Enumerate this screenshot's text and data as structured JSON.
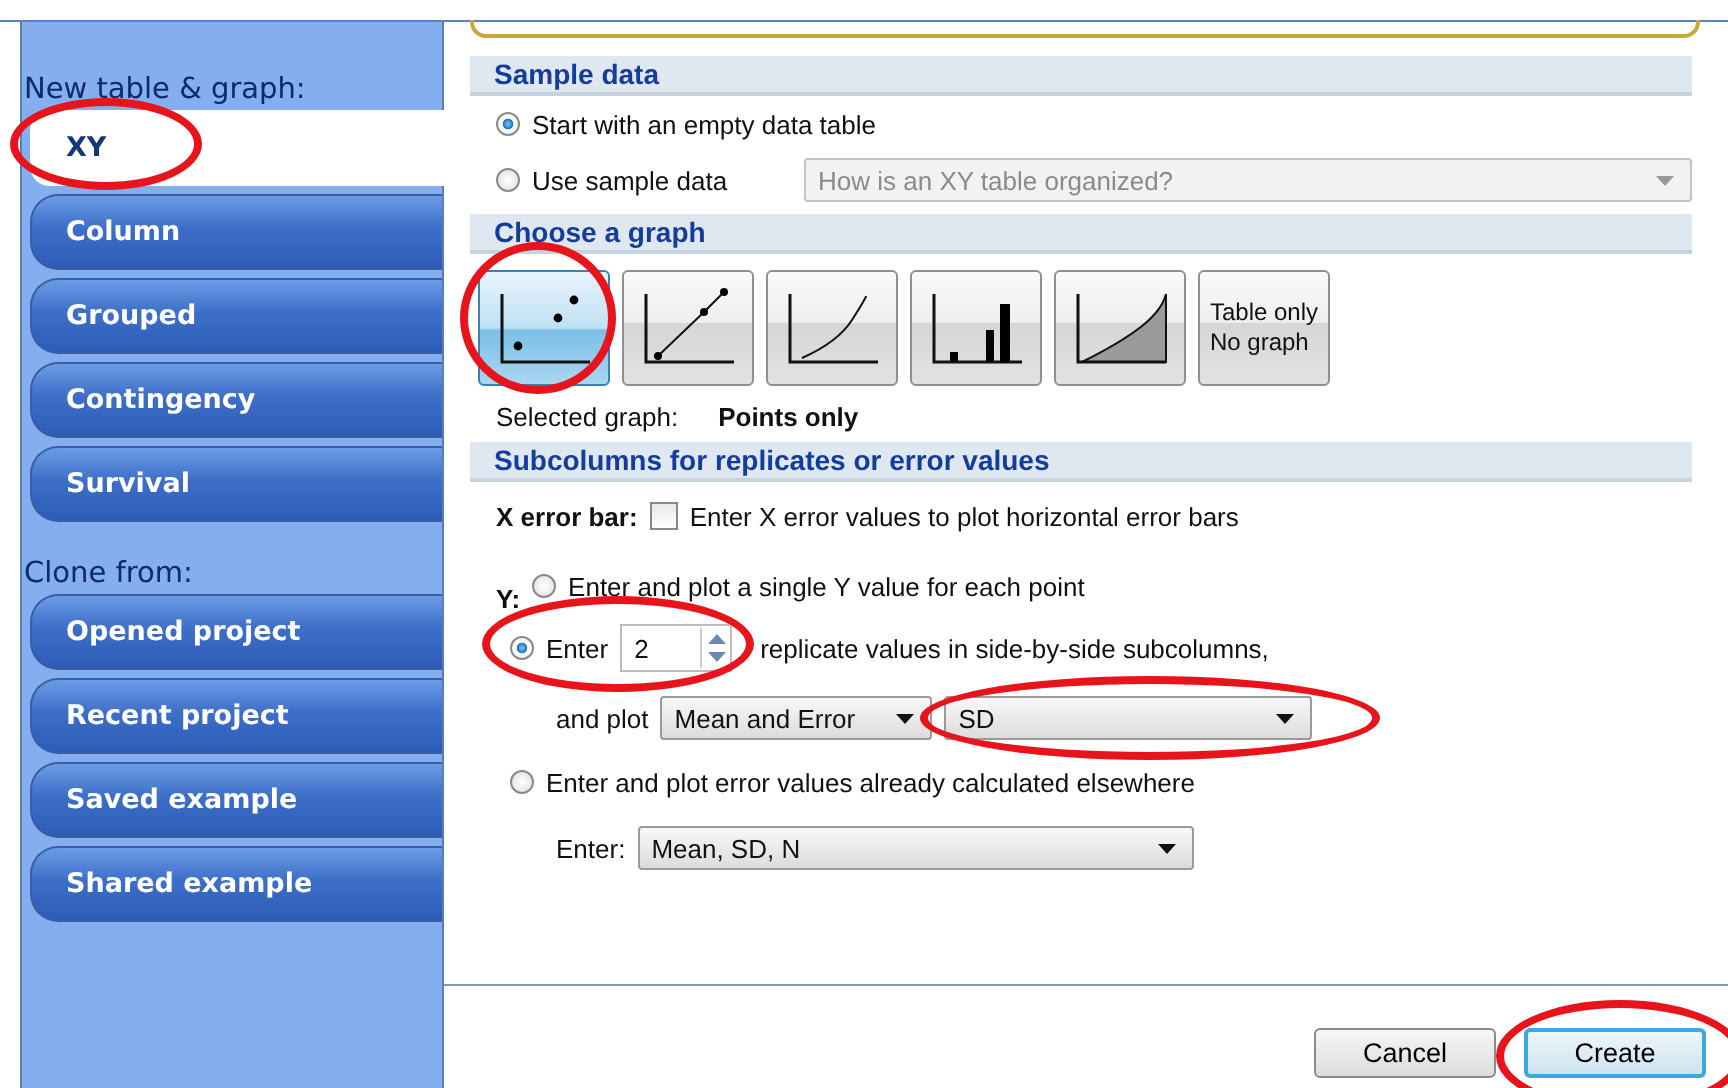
{
  "sidebar": {
    "new_heading": "New table & graph:",
    "new_items": [
      {
        "label": "XY",
        "selected": true,
        "circled": true
      },
      {
        "label": "Column",
        "selected": false,
        "circled": false
      },
      {
        "label": "Grouped",
        "selected": false,
        "circled": false
      },
      {
        "label": "Contingency",
        "selected": false,
        "circled": false
      },
      {
        "label": "Survival",
        "selected": false,
        "circled": false
      }
    ],
    "clone_heading": "Clone from:",
    "clone_items": [
      {
        "label": "Opened project",
        "selected": false
      },
      {
        "label": "Recent project",
        "selected": false
      },
      {
        "label": "Saved example",
        "selected": false
      },
      {
        "label": "Shared example",
        "selected": false
      }
    ]
  },
  "sample_data": {
    "title": "Sample data",
    "options": [
      {
        "label": "Start with an empty data table",
        "selected": true
      },
      {
        "label": "Use sample data",
        "selected": false
      }
    ],
    "sample_dropdown": {
      "value": "How is an XY table organized?",
      "disabled": true
    }
  },
  "choose_graph": {
    "title": "Choose a graph",
    "graphs": [
      {
        "kind": "points",
        "selected": true,
        "circled": true
      },
      {
        "kind": "line",
        "selected": false,
        "circled": false
      },
      {
        "kind": "curve",
        "selected": false,
        "circled": false
      },
      {
        "kind": "bars",
        "selected": false,
        "circled": false
      },
      {
        "kind": "area",
        "selected": false,
        "circled": false
      },
      {
        "kind": "text",
        "lines": [
          "Table only",
          "No graph"
        ],
        "selected": false,
        "circled": false
      }
    ],
    "selected_label": "Selected graph:",
    "selected_value": "Points only"
  },
  "subcolumns": {
    "title": "Subcolumns for replicates or error values",
    "x_error_label": "X error bar:",
    "x_error_checkbox": {
      "label": "Enter X error values to plot horizontal error bars",
      "checked": false
    },
    "y_label": "Y:",
    "y_options": [
      {
        "kind": "single",
        "label": "Enter and plot a single Y value for each point",
        "selected": false
      },
      {
        "kind": "replicates",
        "label_before": "Enter",
        "replicates": "2",
        "label_after": "replicate values in side-by-side subcolumns,",
        "selected": true,
        "circled": true,
        "plot_label": "and plot",
        "plot_dropdown": "Mean and Error",
        "error_dropdown": {
          "value": "SD",
          "circled": true
        }
      },
      {
        "kind": "calculated",
        "label": "Enter and plot error values already calculated elsewhere",
        "selected": false,
        "format_label": "Enter:",
        "format_dropdown": "Mean, SD, N"
      }
    ]
  },
  "buttons": [
    {
      "label": "Cancel",
      "default": false,
      "circled": false
    },
    {
      "label": "Create",
      "default": true,
      "circled": true
    }
  ]
}
